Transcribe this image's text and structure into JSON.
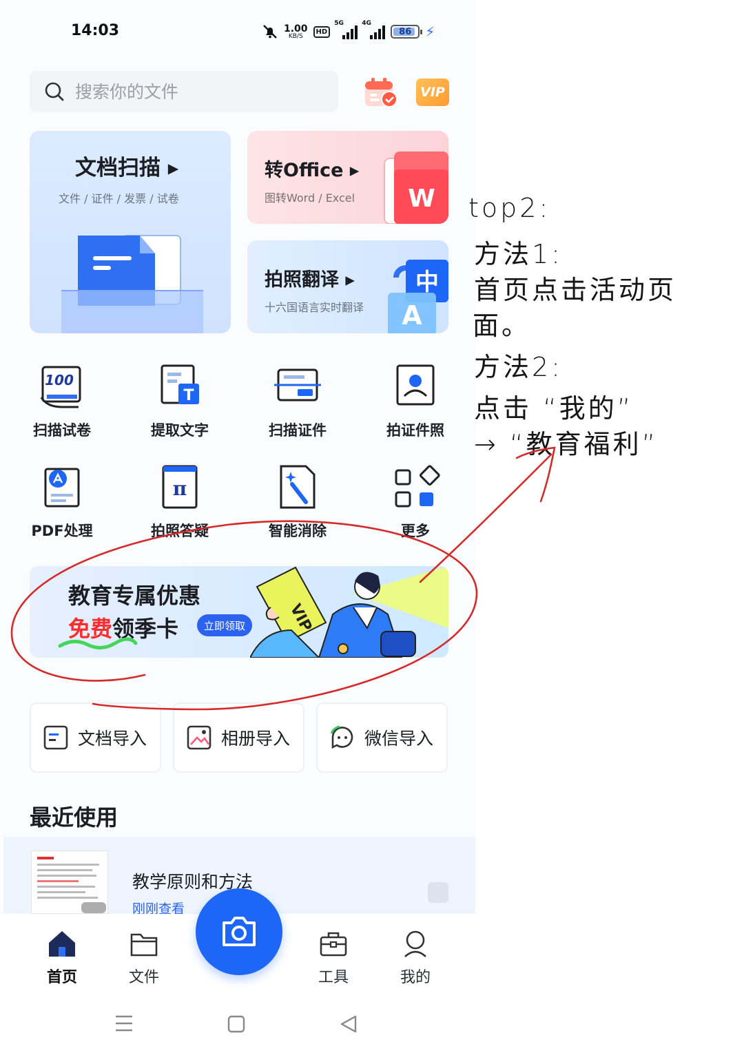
{
  "status_bar": {
    "time": "14:03",
    "net_speed_value": "1.00",
    "net_speed_unit": "KB/S",
    "hd_label": "HD",
    "signal1_label": "5G",
    "signal2_label": "4G",
    "battery": "86"
  },
  "search": {
    "placeholder": "搜索你的文件"
  },
  "header": {
    "vip_label": "VIP"
  },
  "cards": {
    "scan": {
      "title": "文档扫描 ▸",
      "subtitle": "文件 / 证件 / 发票 / 试卷"
    },
    "office": {
      "title": "转Office ▸",
      "subtitle": "图转Word / Excel",
      "badge": "W"
    },
    "translate": {
      "title": "拍照翻译 ▸",
      "subtitle": "十六国语言实时翻译",
      "badge_top": "中",
      "badge_bottom": "A"
    }
  },
  "tools": [
    {
      "label": "扫描试卷",
      "icon": "exam-scan-icon",
      "badge": "100"
    },
    {
      "label": "提取文字",
      "icon": "text-extract-icon",
      "badge": "T"
    },
    {
      "label": "扫描证件",
      "icon": "id-scan-icon"
    },
    {
      "label": "拍证件照",
      "icon": "id-photo-icon"
    },
    {
      "label": "PDF处理",
      "icon": "pdf-icon"
    },
    {
      "label": "拍照答疑",
      "icon": "photo-qa-icon",
      "badge": "π"
    },
    {
      "label": "智能消除",
      "icon": "smart-erase-icon"
    },
    {
      "label": "更多",
      "icon": "more-grid-icon"
    }
  ],
  "banner": {
    "line1": "教育专属优惠",
    "line2_red": "免费",
    "line2_rest": "领季卡",
    "claim_button": "立即领取",
    "art_text": "VIP"
  },
  "imports": [
    {
      "label": "文档导入",
      "icon": "document-import-icon"
    },
    {
      "label": "相册导入",
      "icon": "album-import-icon"
    },
    {
      "label": "微信导入",
      "icon": "wechat-import-icon"
    }
  ],
  "recent": {
    "title": "最近使用",
    "item_name": "教学原则和方法",
    "item_time": "刚刚查看"
  },
  "nav": {
    "home": "首页",
    "files": "文件",
    "tools": "工具",
    "mine": "我的"
  },
  "annotation": {
    "lines": [
      "top2:",
      "方法1:",
      "首页点击活动页",
      "面。",
      "方法2:",
      "点击 “我的”",
      "→ “教育福利”"
    ]
  },
  "colors": {
    "accent": "#1e66f5",
    "annotation_ink": "#d42a2a",
    "promo_red": "#ff2d2d"
  }
}
